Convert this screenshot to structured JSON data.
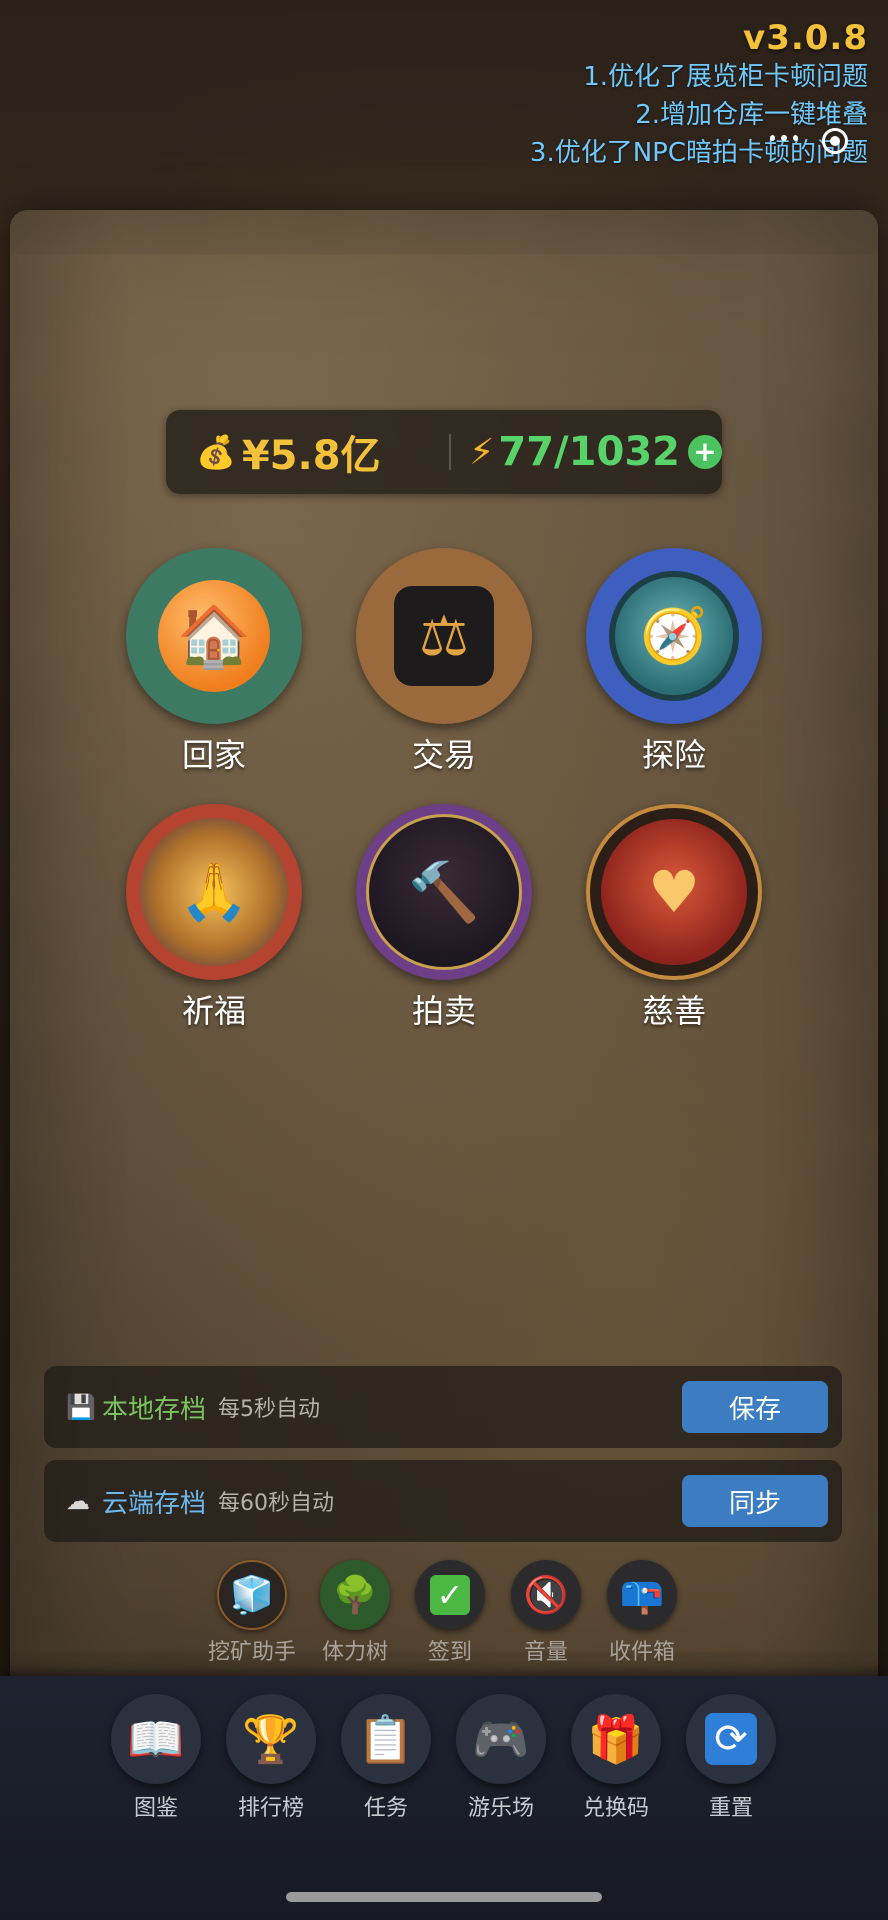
{
  "version": {
    "number": "v3.0.8",
    "notes": [
      "1.优化了展览柜卡顿问题",
      "2.增加仓库一键堆叠",
      "3.优化了NPC暗拍卡顿的问题"
    ]
  },
  "currency": {
    "money_icon": "money-bag-icon",
    "money": "¥5.8亿",
    "energy_icon": "lightning-icon",
    "energy": "77/1032",
    "add_icon": "plus-icon"
  },
  "menu": [
    {
      "label": "回家",
      "icon": "house-icon",
      "color": "#3d7a63"
    },
    {
      "label": "交易",
      "icon": "scales-icon",
      "color": "#9a6a3d"
    },
    {
      "label": "探险",
      "icon": "compass-map-icon",
      "color": "#3e5fbf"
    },
    {
      "label": "祈福",
      "icon": "praying-hands-icon",
      "color": "#b4432f"
    },
    {
      "label": "拍卖",
      "icon": "gavel-icon",
      "color": "#6c3f86"
    },
    {
      "label": "慈善",
      "icon": "heart-hands-icon",
      "color": "#2b1e17"
    }
  ],
  "saves": [
    {
      "title": "本地存档",
      "subtitle": "每5秒自动",
      "button": "保存",
      "icon": "floppy-icon"
    },
    {
      "title": "云端存档",
      "subtitle": "每60秒自动",
      "button": "同步",
      "icon": "cloud-icon"
    }
  ],
  "tools": [
    {
      "label": "挖矿助手",
      "icon": "ice-cube-icon"
    },
    {
      "label": "体力树",
      "icon": "tree-icon"
    },
    {
      "label": "签到",
      "icon": "checkmark-icon"
    },
    {
      "label": "音量",
      "icon": "mute-icon"
    },
    {
      "label": "收件箱",
      "icon": "mailbox-icon"
    }
  ],
  "nav": [
    {
      "label": "图鉴",
      "icon": "book-icon"
    },
    {
      "label": "排行榜",
      "icon": "trophy-icon"
    },
    {
      "label": "任务",
      "icon": "clipboard-icon"
    },
    {
      "label": "游乐场",
      "icon": "gamepad-icon"
    },
    {
      "label": "兑换码",
      "icon": "gift-icon"
    },
    {
      "label": "重置",
      "icon": "refresh-icon"
    }
  ],
  "colors": {
    "accent_gold": "#f3c23a",
    "energy_green": "#58d36a",
    "link_blue": "#6fc9ff",
    "button_blue": "#3c7dc2"
  }
}
